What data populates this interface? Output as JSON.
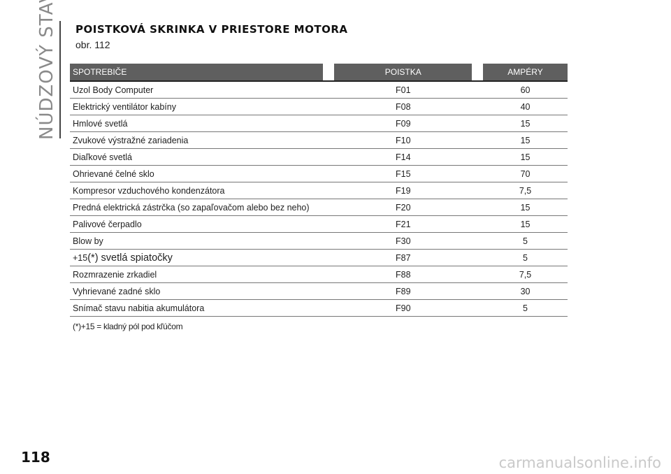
{
  "chapter": "NÚDZOVÝ STAV",
  "title": "POISTKOVÁ SKRINKA V PRIESTORE MOTORA",
  "figure_ref": "obr. 112",
  "table": {
    "headers": [
      "SPOTREBIČE",
      "POISTKA",
      "AMPÉRY"
    ],
    "rows": [
      {
        "consumer": "Uzol Body Computer",
        "fuse": "F01",
        "amps": "60"
      },
      {
        "consumer": "Elektrický ventilátor kabíny",
        "fuse": "F08",
        "amps": "40"
      },
      {
        "consumer": "Hmlové svetlá",
        "fuse": "F09",
        "amps": "15"
      },
      {
        "consumer": "Zvukové výstražné zariadenia",
        "fuse": "F10",
        "amps": "15"
      },
      {
        "consumer": "Diaľkové svetlá",
        "fuse": "F14",
        "amps": "15"
      },
      {
        "consumer": "Ohrievané čelné sklo",
        "fuse": "F15",
        "amps": "70"
      },
      {
        "consumer": "Kompresor vzduchového kondenzátora",
        "fuse": "F19",
        "amps": "7,5"
      },
      {
        "consumer": "Predná elektrická zástrčka (so zapaľovačom alebo bez neho)",
        "fuse": "F20",
        "amps": "15"
      },
      {
        "consumer": "Palivové čerpadlo",
        "fuse": "F21",
        "amps": "15"
      },
      {
        "consumer": "Blow by",
        "fuse": "F30",
        "amps": "5"
      },
      {
        "consumer_prefix": "+15",
        "consumer": "(*) svetlá spiatočky",
        "fuse": "F87",
        "amps": "5"
      },
      {
        "consumer": "Rozmrazenie zrkadiel",
        "fuse": "F88",
        "amps": "7,5"
      },
      {
        "consumer": "Vyhrievané zadné sklo",
        "fuse": "F89",
        "amps": "30"
      },
      {
        "consumer": "Snímač stavu nabitia akumulátora",
        "fuse": "F90",
        "amps": "5"
      }
    ]
  },
  "footnote": "(*)+15 = kladný pól pod kľúčom",
  "page_number": "118",
  "watermark": "carmanualsonline.info"
}
